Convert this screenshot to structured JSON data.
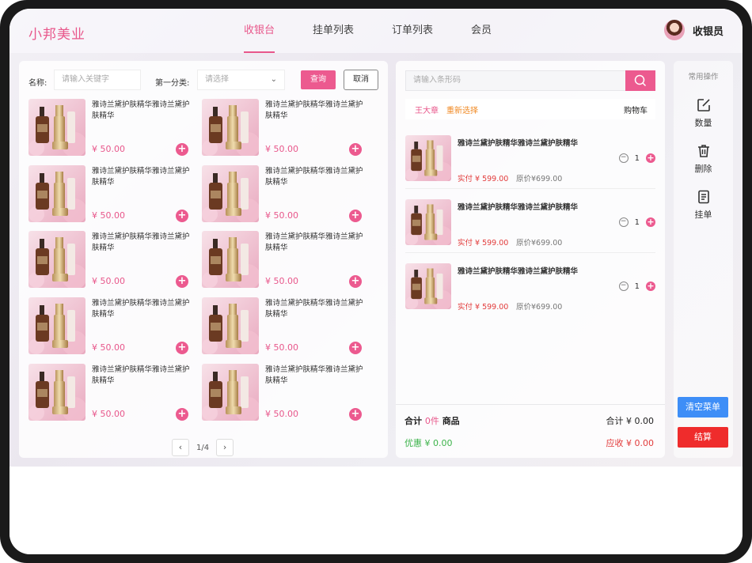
{
  "header": {
    "logo": "小邦美业",
    "tabs": [
      "收银台",
      "挂单列表",
      "订单列表",
      "会员"
    ],
    "active_tab": "收银台",
    "user_name": "收银员"
  },
  "filter": {
    "name_label": "名称:",
    "name_placeholder": "请输入关键字",
    "category_label": "第一分类:",
    "category_placeholder": "请选择",
    "query_label": "查询",
    "cancel_label": "取消"
  },
  "products": [
    {
      "title": "雅诗兰黛护肤精华雅诗兰黛护肤精华",
      "price": "¥ 50.00"
    },
    {
      "title": "雅诗兰黛护肤精华雅诗兰黛护肤精华",
      "price": "¥ 50.00"
    },
    {
      "title": "雅诗兰黛护肤精华雅诗兰黛护肤精华",
      "price": "¥ 50.00"
    },
    {
      "title": "雅诗兰黛护肤精华雅诗兰黛护肤精华",
      "price": "¥ 50.00"
    },
    {
      "title": "雅诗兰黛护肤精华雅诗兰黛护肤精华",
      "price": "¥ 50.00"
    },
    {
      "title": "雅诗兰黛护肤精华雅诗兰黛护肤精华",
      "price": "¥ 50.00"
    },
    {
      "title": "雅诗兰黛护肤精华雅诗兰黛护肤精华",
      "price": "¥ 50.00"
    },
    {
      "title": "雅诗兰黛护肤精华雅诗兰黛护肤精华",
      "price": "¥ 50.00"
    },
    {
      "title": "雅诗兰黛护肤精华雅诗兰黛护肤精华",
      "price": "¥ 50.00"
    },
    {
      "title": "雅诗兰黛护肤精华雅诗兰黛护肤精华",
      "price": "¥ 50.00"
    }
  ],
  "pager": {
    "text": "1/4",
    "prev": "‹",
    "next": "›"
  },
  "cart": {
    "scan_placeholder": "请输入条形码",
    "member": "王大章",
    "reselect": "重新选择",
    "title": "购物车",
    "items": [
      {
        "title": "雅诗兰黛护肤精华雅诗兰黛护肤精华",
        "paid": "实付 ¥ 599.00",
        "original": "原价¥699.00",
        "qty": "1"
      },
      {
        "title": "雅诗兰黛护肤精华雅诗兰黛护肤精华",
        "paid": "实付 ¥ 599.00",
        "original": "原价¥699.00",
        "qty": "1"
      },
      {
        "title": "雅诗兰黛护肤精华雅诗兰黛护肤精华",
        "paid": "实付 ¥ 599.00",
        "original": "原价¥699.00",
        "qty": "1"
      }
    ],
    "totals": {
      "count_prefix": "合计",
      "count": "0件",
      "count_suffix": "商品",
      "total": "合计 ¥ 0.00",
      "discount": "优惠 ¥ 0.00",
      "due": "应收 ¥ 0.00"
    }
  },
  "ops": {
    "title": "常用操作",
    "quantity": "数量",
    "delete": "删除",
    "hold": "挂单",
    "clear": "清空菜单",
    "checkout": "结算"
  },
  "colors": {
    "accent": "#ec5a8f",
    "blue": "#3e8ef7",
    "red": "#ef2c2c",
    "green": "#3cb34a"
  },
  "icons": {
    "search": "search-icon",
    "quantity": "edit-icon",
    "delete": "trash-icon",
    "hold": "document-icon",
    "dropdown": "chevron-down-icon"
  }
}
